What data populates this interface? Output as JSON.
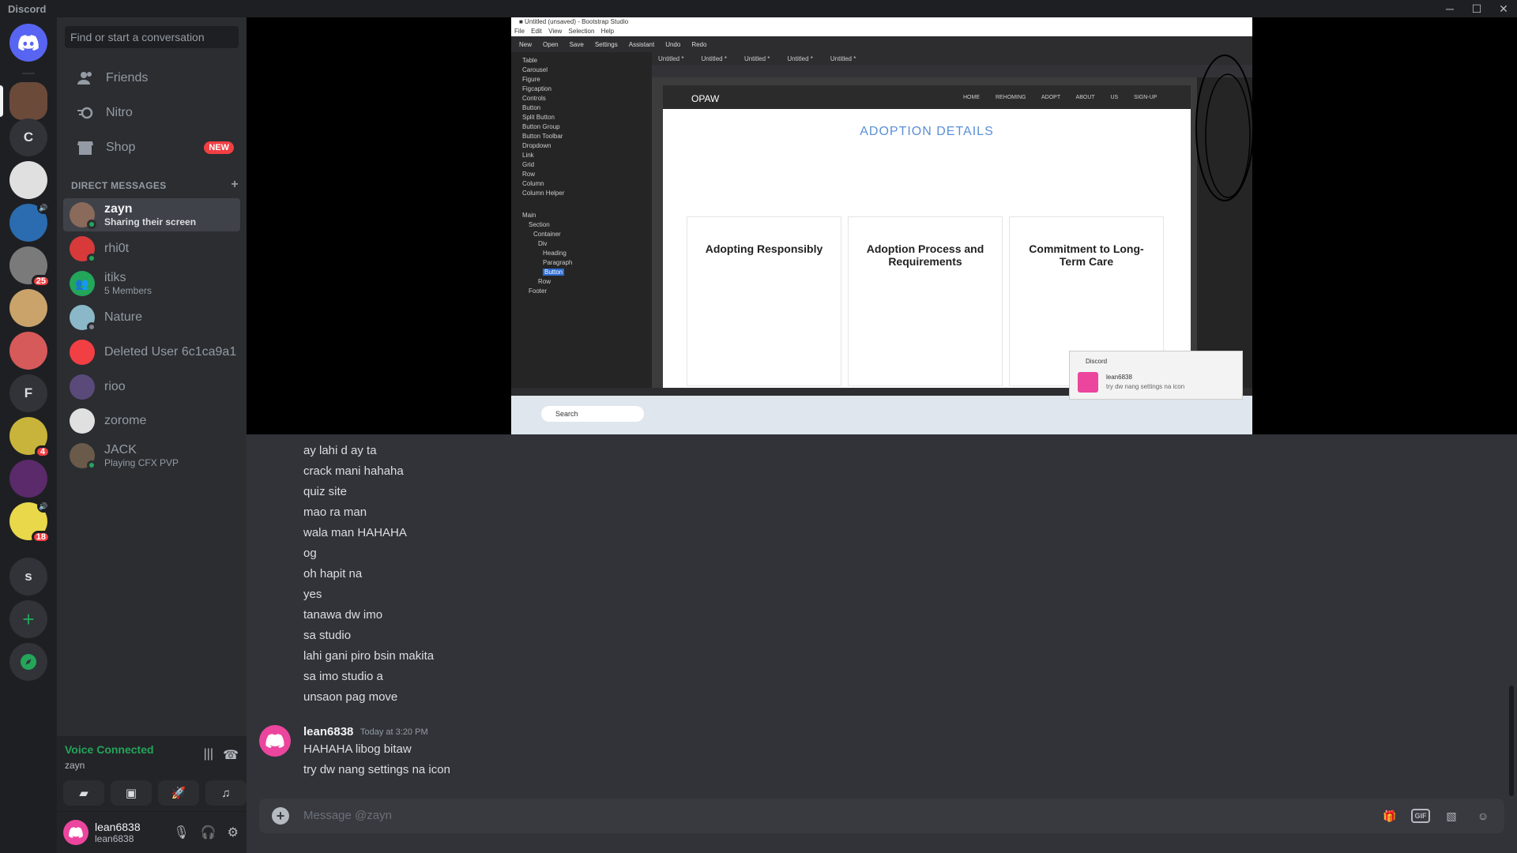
{
  "window": {
    "title": "Discord",
    "controls": [
      "minimize",
      "maximize",
      "close"
    ]
  },
  "servers": {
    "items": [
      {
        "name": "home",
        "icon": "discord-logo-icon",
        "color": "#5865f2"
      },
      {
        "name": "server-avatar-1",
        "color": "#6b4a3a"
      },
      {
        "name": "C",
        "label": "C",
        "color": "#313338"
      },
      {
        "name": "server-avatar-3",
        "color": "#e0e0e0"
      },
      {
        "name": "server-avatar-4",
        "color": "#2b6cb0"
      },
      {
        "name": "server-avatar-5",
        "color": "#7a7a7a",
        "badge": "25"
      },
      {
        "name": "server-avatar-6",
        "color": "#c9a36a"
      },
      {
        "name": "server-avatar-7",
        "color": "#d65a5a"
      },
      {
        "name": "F",
        "label": "F",
        "color": "#313338"
      },
      {
        "name": "server-avatar-9",
        "color": "#c8b43a",
        "badge": "4"
      },
      {
        "name": "server-avatar-10",
        "color": "#5a2a6a"
      },
      {
        "name": "server-avatar-11",
        "color": "#e8d84a",
        "badge": "18"
      },
      {
        "name": "S",
        "label": "s",
        "color": "#313338"
      }
    ]
  },
  "sidebar": {
    "search_placeholder": "Find or start a conversation",
    "nav": [
      {
        "label": "Friends",
        "icon": "friends-icon"
      },
      {
        "label": "Nitro",
        "icon": "nitro-icon"
      },
      {
        "label": "Shop",
        "icon": "shop-icon",
        "badge": "NEW"
      }
    ],
    "dm_header": "DIRECT MESSAGES",
    "dms": [
      {
        "name": "zayn",
        "sub": "Sharing their screen",
        "color": "#8a6a5a",
        "status": "#23a55a"
      },
      {
        "name": "rhi0t",
        "sub": "",
        "color": "#d83a3a",
        "status": "#23a55a"
      },
      {
        "name": "itiks",
        "sub": "5 Members",
        "color": "#23a55a",
        "status": ""
      },
      {
        "name": "Nature",
        "sub": "",
        "color": "#8ab8c8",
        "status": "#80848e"
      },
      {
        "name": "Deleted User 6c1ca9a1",
        "sub": "",
        "color": "#f23f43",
        "status": ""
      },
      {
        "name": "rioo",
        "sub": "",
        "color": "#5a4a7a",
        "status": ""
      },
      {
        "name": "zorome",
        "sub": "",
        "color": "#e0e0e0",
        "status": ""
      },
      {
        "name": "JACK",
        "sub": "Playing CFX PVP",
        "color": "#6a5a4a",
        "status": "#23a55a"
      }
    ]
  },
  "voice": {
    "status": "Voice Connected",
    "channel": "zayn"
  },
  "user": {
    "name": "lean6838",
    "tag": "lean6838"
  },
  "stream": {
    "menu": "File Edit View Selection Help",
    "toolbar": [
      "New",
      "Open",
      "Save",
      "Settings",
      "Assistant",
      "Undo",
      "Redo"
    ],
    "tabs": [
      "Untitled *",
      "Untitled *",
      "Untitled *",
      "Untitled *",
      "Untitled *"
    ],
    "components": [
      "Table",
      "Carousel",
      "Figure",
      "Figcaption",
      "Controls",
      "Button",
      "Split Button",
      "Button Group",
      "Button Toolbar",
      "Dropdown",
      "Link",
      "Grid",
      "Row",
      "Column",
      "Column Helper"
    ],
    "overview": [
      "Main",
      "Section",
      "Container",
      "Div",
      "Heading",
      "Paragraph",
      "Button",
      "Row",
      "Footer"
    ],
    "site_logo": "OPAW",
    "site_nav": "HOME REHOMING ADOPT ABOUT US SIGN-UP",
    "page_title": "ADOPTION DETAILS",
    "cards": [
      "Adopting Responsibly",
      "Adoption Process and Requirements",
      "Commitment to Long-Term Care"
    ],
    "taskbar_search": "Search",
    "toast_app": "Discord",
    "toast_name": "lean6838",
    "toast_msg": "try dw nang settings na icon"
  },
  "messages": [
    "ay lahi d ay ta",
    "crack mani hahaha",
    "quiz site",
    "mao ra man",
    "wala man HAHAHA",
    "og",
    "oh hapit na",
    "yes",
    "tanawa dw imo",
    "sa studio",
    "lahi gani piro bsin makita",
    "sa imo studio a",
    "unsaon pag move"
  ],
  "last_group": {
    "author": "lean6838",
    "time": "Today at 3:20 PM",
    "lines": [
      "HAHAHA libog bitaw",
      "try dw nang settings na icon"
    ]
  },
  "composer": {
    "placeholder": "Message @zayn",
    "tools": [
      "gift-icon",
      "GIF",
      "sticker-icon",
      "emoji-icon"
    ]
  }
}
